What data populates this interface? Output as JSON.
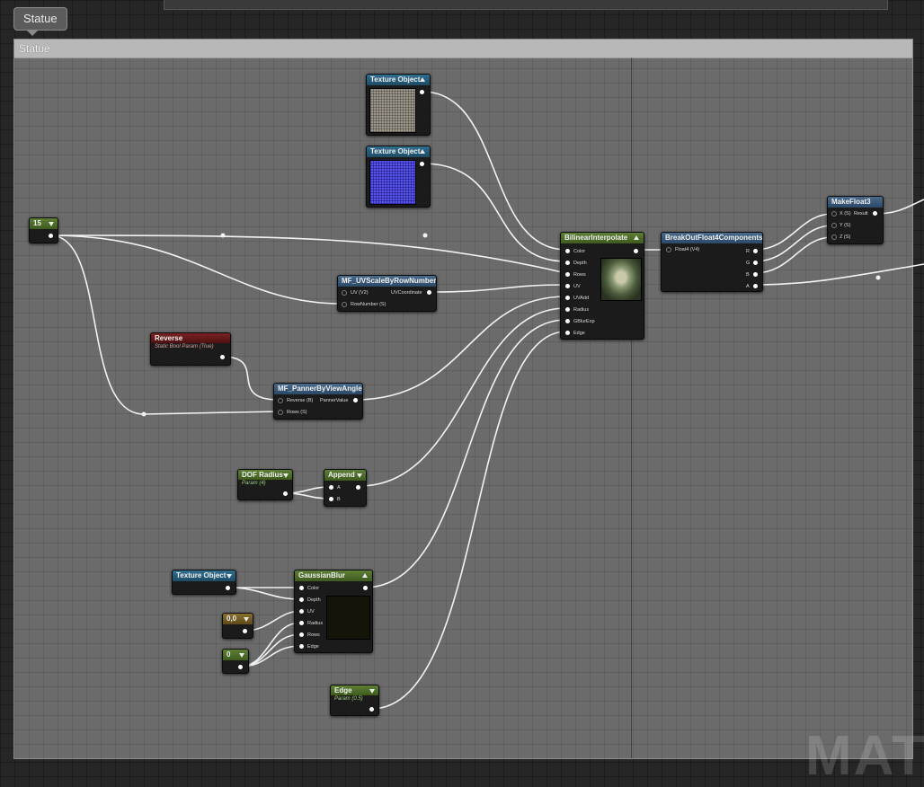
{
  "tab": {
    "label": "Statue"
  },
  "comment": {
    "title": "Statue"
  },
  "watermark": {
    "text": "MATE"
  },
  "nodes": {
    "texture1": {
      "title": "Texture Object"
    },
    "texture2": {
      "title": "Texture Object"
    },
    "const15": {
      "value": "15"
    },
    "uvscale": {
      "title": "MF_UVScaleByRowNumber",
      "in1": "UV (V2)",
      "out1": "UVCoordinate",
      "in2": "RowNumber (S)"
    },
    "reverse": {
      "title": "Reverse",
      "subtitle": "Static Bool Param (True)"
    },
    "panner": {
      "title": "MF_PannerByViewAngle",
      "in1": "Reverse (B)",
      "out1": "PannerValue",
      "in2": "Rows (S)"
    },
    "bilinear": {
      "title": "BilinearInterpolate",
      "pins": [
        "Color",
        "Depth",
        "Rows",
        "UV",
        "UVAdd",
        "Radius",
        "GBlurExp",
        "Edge"
      ]
    },
    "breakout": {
      "title": "BreakOutFloat4Components",
      "in1": "Float4 (V4)",
      "outs": [
        "R",
        "G",
        "B",
        "A"
      ]
    },
    "makefloat3": {
      "title": "MakeFloat3",
      "ins": [
        "X (S)",
        "Y (S)",
        "Z (S)"
      ],
      "out1": "Result"
    },
    "dof": {
      "title": "DOF Radius",
      "subtitle": "Param (4)"
    },
    "append": {
      "title": "Append",
      "ins": [
        "A",
        "B"
      ]
    },
    "texture3": {
      "title": "Texture Object"
    },
    "gaussian": {
      "title": "GaussianBlur",
      "pins": [
        "Color",
        "Depth",
        "UV",
        "Radius",
        "Rows",
        "Edge"
      ]
    },
    "const00": {
      "value": "0,0"
    },
    "const0": {
      "value": "0"
    },
    "edge": {
      "title": "Edge",
      "subtitle": "Param (0.5)"
    }
  }
}
